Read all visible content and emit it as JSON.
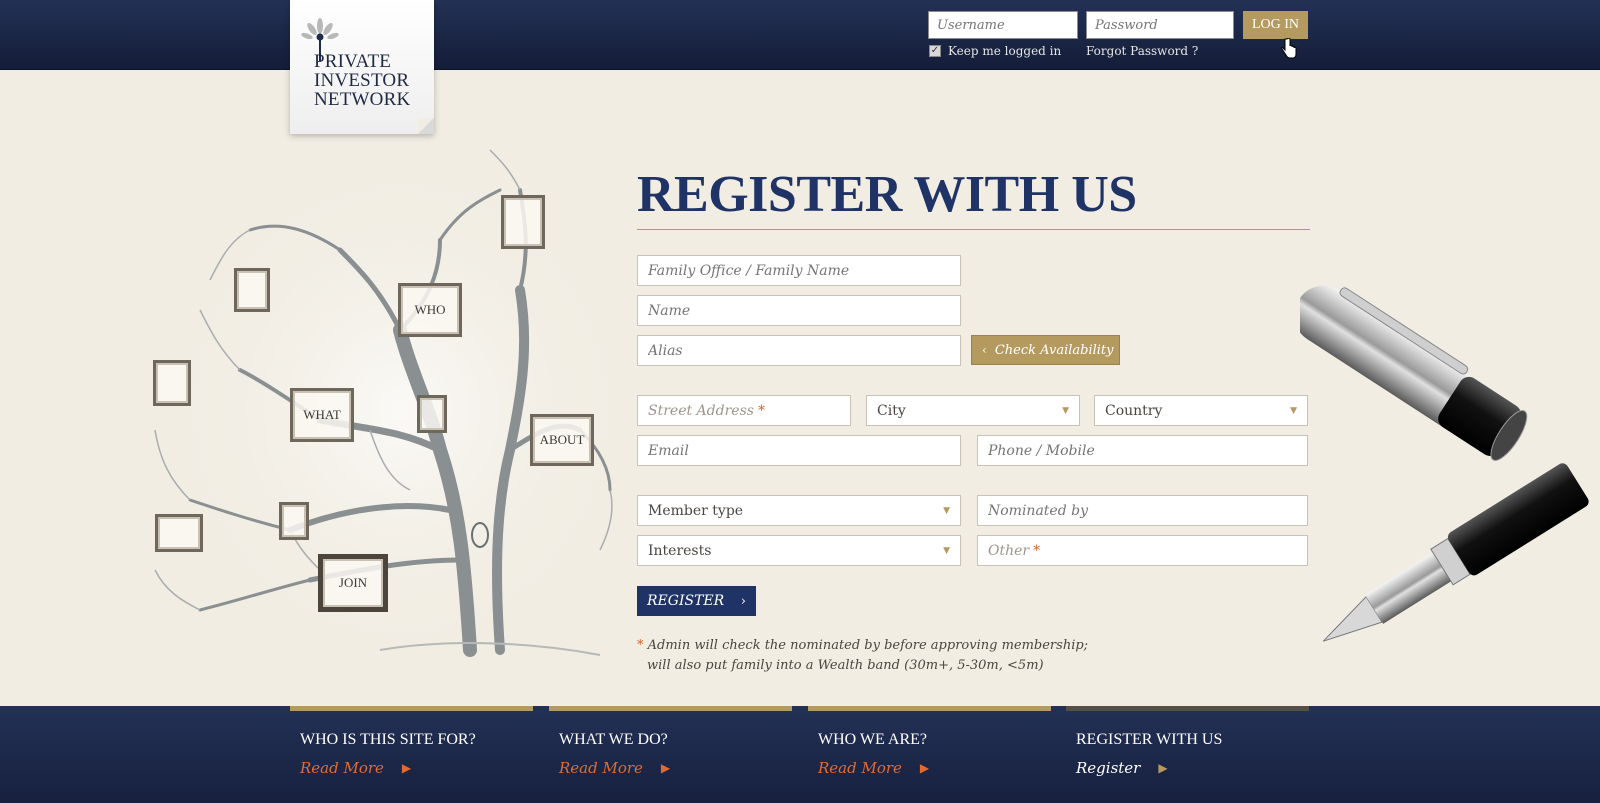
{
  "header": {
    "logo_lines": [
      "PRIVATE",
      "INVESTOR",
      "NETWORK"
    ],
    "username_placeholder": "Username",
    "password_placeholder": "Password",
    "login_label": "LOG IN",
    "keep_logged_in": "Keep me logged in",
    "forgot_password": "Forgot Password ?"
  },
  "tree": {
    "frames": [
      "WHO",
      "WHAT",
      "ABOUT",
      "JOIN"
    ]
  },
  "form": {
    "title": "REGISTER WITH US",
    "family_office_placeholder": "Family Office / Family Name",
    "name_placeholder": "Name",
    "alias_placeholder": "Alias",
    "check_availability": "Check Availability",
    "street_placeholder": "Street Address",
    "city_value": "City",
    "country_value": "Country",
    "email_placeholder": "Email",
    "phone_placeholder": "Phone / Mobile",
    "member_type_value": "Member type",
    "nominated_placeholder": "Nominated by",
    "interests_value": "Interests",
    "other_placeholder": "Other",
    "required_mark": "*",
    "register_label": "REGISTER",
    "note_line1": "Admin will check the nominated by before approving membership;",
    "note_line2": "will also put family into a Wealth band (30m+, 5-30m, <5m)"
  },
  "footer": {
    "columns": [
      {
        "title": "WHO IS THIS SITE FOR?",
        "link": "Read More"
      },
      {
        "title": "WHAT WE DO?",
        "link": "Read More"
      },
      {
        "title": "WHO WE ARE?",
        "link": "Read More"
      },
      {
        "title": "REGISTER WITH US",
        "link": "Register"
      }
    ]
  },
  "colors": {
    "navy": "#1f3366",
    "gold": "#b59a5f",
    "accent_orange": "#e06a32",
    "background": "#f1ede3"
  }
}
